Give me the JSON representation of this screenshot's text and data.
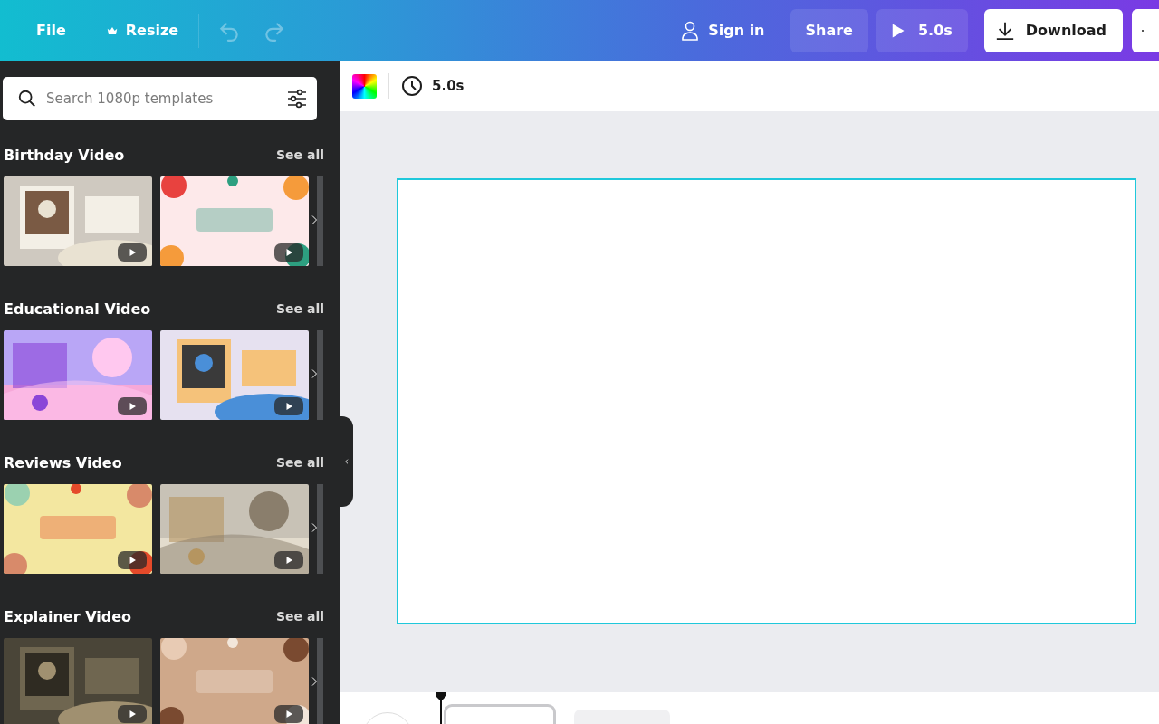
{
  "topbar": {
    "file": "File",
    "resize": "Resize",
    "undo": {
      "disabled": true
    },
    "redo": {
      "disabled": true
    },
    "sign_in": "Sign in",
    "share": "Share",
    "play_duration": "5.0s",
    "download": "Download"
  },
  "sidebar": {
    "search": {
      "placeholder": "Search 1080p templates"
    },
    "sections": [
      {
        "title": "Birthday Video",
        "see_all": "See all"
      },
      {
        "title": "Educational Video",
        "see_all": "See all"
      },
      {
        "title": "Reviews Video",
        "see_all": "See all"
      },
      {
        "title": "Explainer Video",
        "see_all": "See all"
      }
    ]
  },
  "toolbar": {
    "duration": "5.0s"
  },
  "canvas": {
    "selected": true
  }
}
